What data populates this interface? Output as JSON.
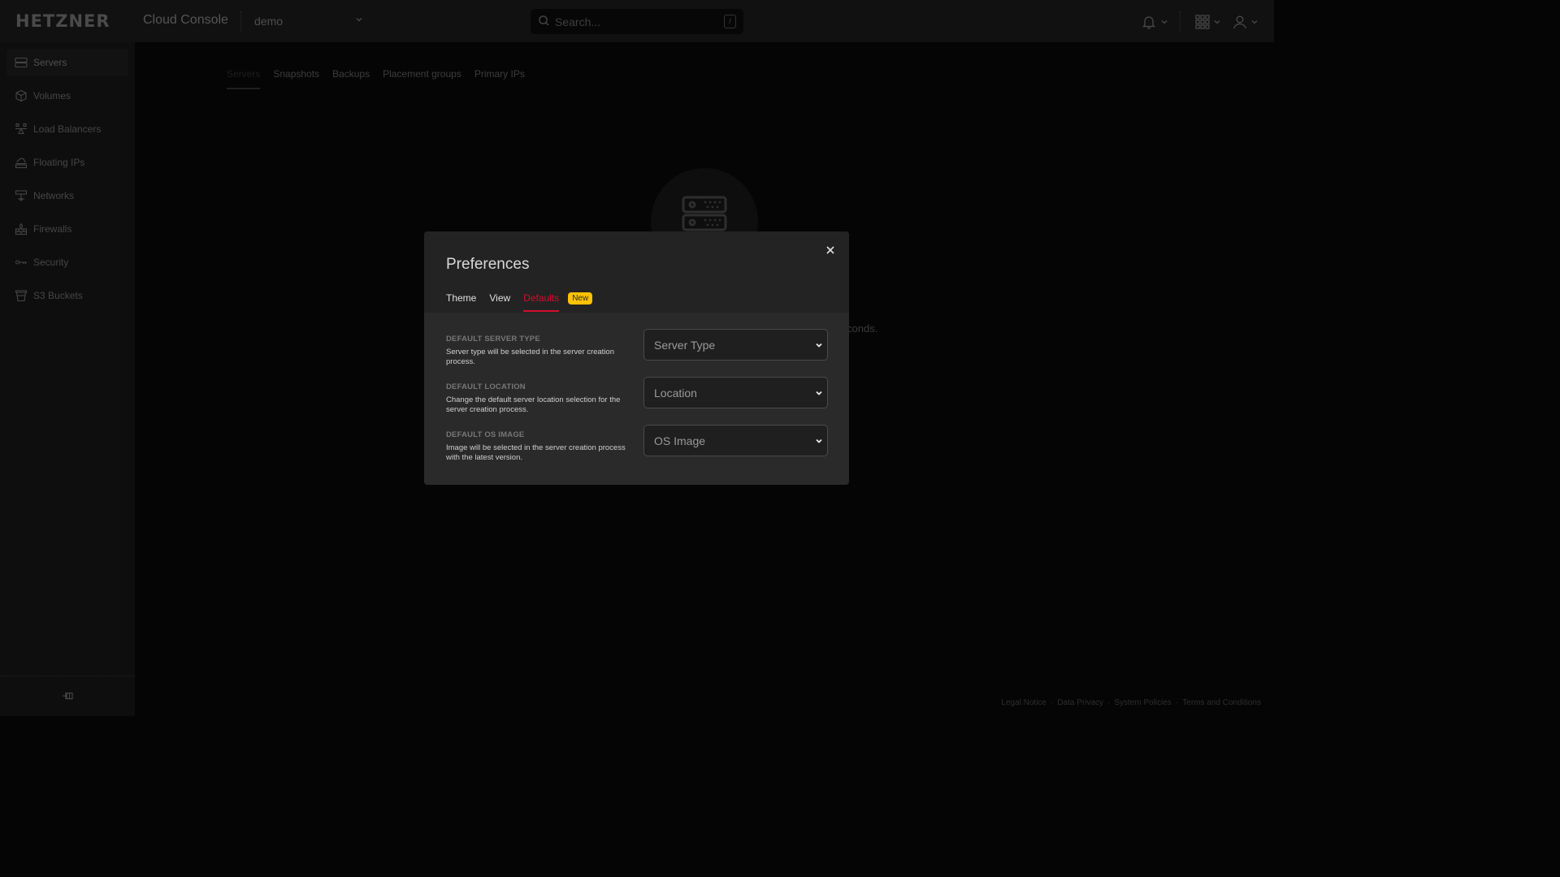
{
  "header": {
    "logo": "HETZNER",
    "app_title": "Cloud Console",
    "project": "demo",
    "search_placeholder": "Search...",
    "search_shortcut": "/",
    "icons": [
      "bell-icon",
      "apps-grid-icon",
      "user-icon"
    ]
  },
  "sidebar": {
    "items": [
      {
        "label": "Servers",
        "icon": "server-icon",
        "active": true
      },
      {
        "label": "Volumes",
        "icon": "cube-icon"
      },
      {
        "label": "Load Balancers",
        "icon": "load-balancer-icon"
      },
      {
        "label": "Floating IPs",
        "icon": "cloud-icon"
      },
      {
        "label": "Networks",
        "icon": "network-icon"
      },
      {
        "label": "Firewalls",
        "icon": "firewall-icon"
      },
      {
        "label": "Security",
        "icon": "key-icon"
      },
      {
        "label": "S3 Buckets",
        "icon": "bucket-icon"
      }
    ],
    "footer_icon": "pin-icon"
  },
  "content": {
    "tabs": [
      {
        "label": "Servers",
        "active": true
      },
      {
        "label": "Snapshots"
      },
      {
        "label": "Backups"
      },
      {
        "label": "Placement groups"
      },
      {
        "label": "Primary IPs"
      }
    ],
    "background_text_fragment": "conds.",
    "footer_links": [
      "Legal Notice",
      "Data Privacy",
      "System Policies",
      "Terms and Conditions"
    ],
    "footer_separator": "·"
  },
  "modal": {
    "title": "Preferences",
    "tabs": [
      {
        "label": "Theme"
      },
      {
        "label": "View"
      },
      {
        "label": "Defaults",
        "active": true
      }
    ],
    "badge": "New",
    "rows": [
      {
        "label": "DEFAULT SERVER TYPE",
        "description": "Server type will be selected in the server creation process.",
        "select_value": "Server Type"
      },
      {
        "label": "DEFAULT LOCATION",
        "description": "Change the default server location selection for the server creation process.",
        "select_value": "Location"
      },
      {
        "label": "DEFAULT OS IMAGE",
        "description": "Image will be selected in the server creation process with the latest version.",
        "select_value": "OS Image"
      }
    ]
  },
  "colors": {
    "accent": "#d50c2d",
    "badge": "#ffc200",
    "modal_bg": "#242424",
    "topbar_bg": "#111111"
  }
}
